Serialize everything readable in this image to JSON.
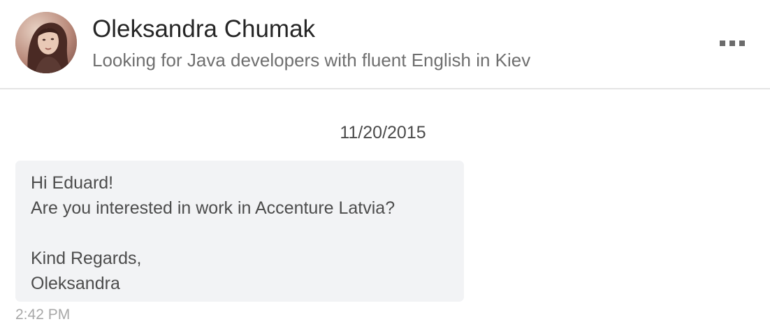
{
  "header": {
    "name": "Oleksandra Chumak",
    "headline": "Looking for Java developers with fluent English in Kiev",
    "more_icon": "more-horizontal-icon"
  },
  "conversation": {
    "date": "11/20/2015",
    "message": {
      "lines": [
        "Hi Eduard!",
        "Are you interested in work in Accenture Latvia?",
        "",
        "Kind Regards,",
        "Oleksandra"
      ],
      "time": "2:42 PM"
    }
  },
  "colors": {
    "bubble_background": "#f2f3f5",
    "header_divider": "#e4e4e4",
    "name_text": "#262626",
    "secondary_text": "#6f6f6f",
    "timestamp_text": "#a8a8a8"
  }
}
